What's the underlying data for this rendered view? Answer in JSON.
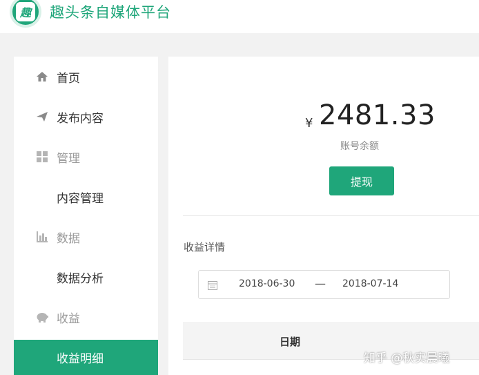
{
  "app": {
    "logo_char": "趣",
    "title": "趣头条自媒体平台"
  },
  "sidebar": {
    "items": [
      {
        "label": "首页",
        "icon": "home-icon"
      },
      {
        "label": "发布内容",
        "icon": "send-icon"
      },
      {
        "label": "管理",
        "icon": "grid-icon"
      },
      {
        "label": "内容管理"
      },
      {
        "label": "数据",
        "icon": "bar-chart-icon"
      },
      {
        "label": "数据分析"
      },
      {
        "label": "收益",
        "icon": "piggy-bank-icon"
      },
      {
        "label": "收益明细",
        "active": true
      }
    ]
  },
  "balance": {
    "currency": "¥",
    "amount": "2481.33",
    "label": "账号余额",
    "withdraw_label": "提现"
  },
  "details": {
    "title": "收益详情",
    "date_start": "2018-06-30",
    "date_separator": "—",
    "date_end": "2018-07-14",
    "column_date": "日期"
  },
  "watermark": "知乎 @秋实晨曦",
  "colors": {
    "accent": "#1fa67a",
    "background": "#f2f2f2"
  }
}
